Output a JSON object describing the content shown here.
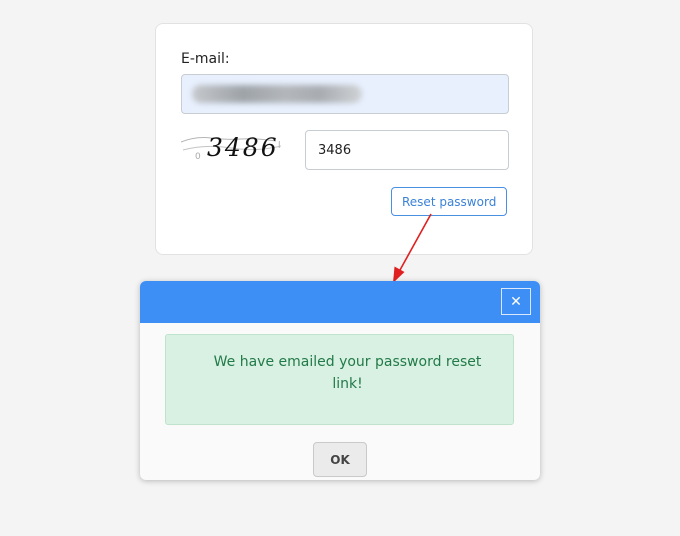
{
  "form": {
    "email_label": "E-mail:",
    "captcha_text": "3486",
    "captcha_value": "3486",
    "reset_label": "Reset password"
  },
  "modal": {
    "close_symbol": "✕",
    "message": "We have emailed your password reset link!",
    "ok_label": "OK"
  },
  "colors": {
    "header": "#3d8ff6",
    "success_bg": "#d9f1e3",
    "success_text": "#227a48",
    "accent": "#4a90e2",
    "annotation_arrow": "#e02020"
  },
  "icons": {
    "close": "close-icon"
  }
}
